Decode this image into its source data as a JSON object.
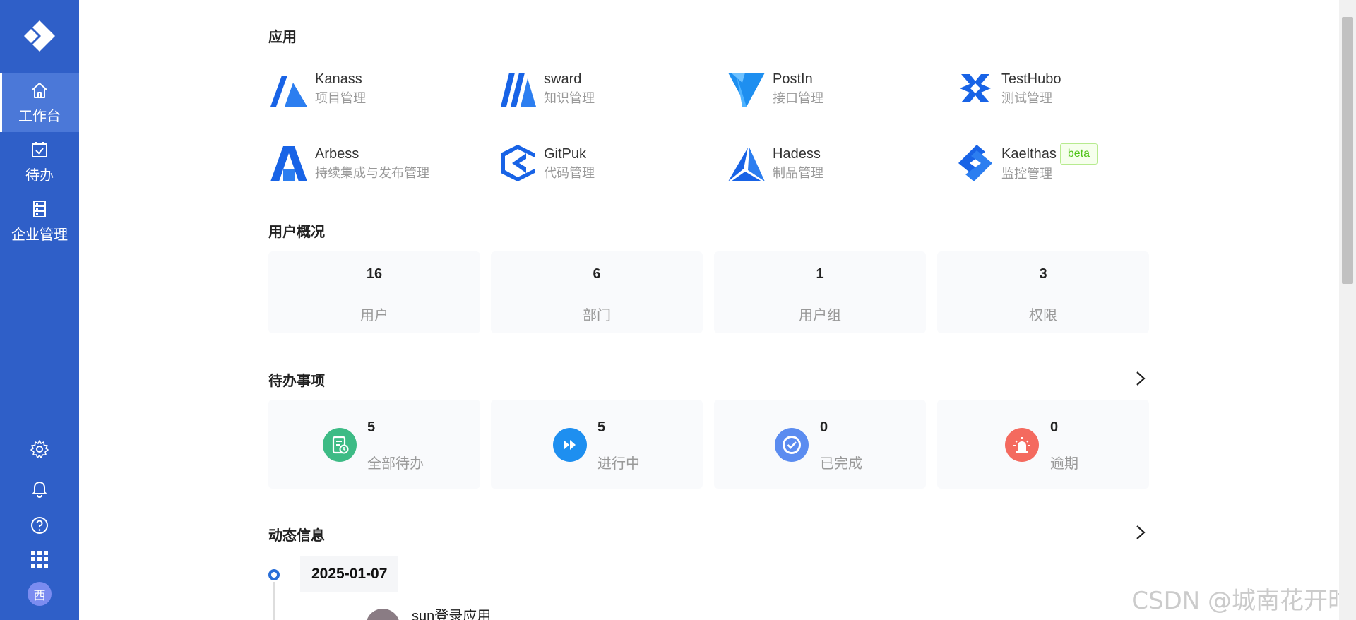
{
  "sidebar": {
    "nav": [
      {
        "label": "工作台",
        "icon": "home-icon",
        "active": true
      },
      {
        "label": "待办",
        "icon": "calendar-check-icon",
        "active": false
      },
      {
        "label": "企业管理",
        "icon": "list-doc-icon",
        "active": false
      }
    ],
    "avatar_text": "西"
  },
  "apps": {
    "title": "应用",
    "items": [
      {
        "name": "Kanass",
        "desc": "项目管理"
      },
      {
        "name": "sward",
        "desc": "知识管理"
      },
      {
        "name": "PostIn",
        "desc": "接口管理"
      },
      {
        "name": "TestHubo",
        "desc": "测试管理"
      },
      {
        "name": "Arbess",
        "desc": "持续集成与发布管理"
      },
      {
        "name": "GitPuk",
        "desc": "代码管理"
      },
      {
        "name": "Hadess",
        "desc": "制品管理"
      },
      {
        "name": "Kaelthas",
        "desc": "监控管理",
        "badge": "beta"
      }
    ]
  },
  "overview": {
    "title": "用户概况",
    "stats": [
      {
        "value": "16",
        "label": "用户"
      },
      {
        "value": "6",
        "label": "部门"
      },
      {
        "value": "1",
        "label": "用户组"
      },
      {
        "value": "3",
        "label": "权限"
      }
    ]
  },
  "todos": {
    "title": "待办事项",
    "items": [
      {
        "value": "5",
        "label": "全部待办",
        "color": "#3dbb85"
      },
      {
        "value": "5",
        "label": "进行中",
        "color": "#1e8ff0"
      },
      {
        "value": "0",
        "label": "已完成",
        "color": "#5b8cf0"
      },
      {
        "value": "0",
        "label": "逾期",
        "color": "#f46a5f"
      }
    ]
  },
  "activity": {
    "title": "动态信息",
    "date": "2025-01-07",
    "entry_text": "sun登录应用"
  },
  "colors": {
    "sidebar": "#2f5fc8",
    "brand_blue": "#2a6fd8"
  },
  "watermark": "CSDN @城南花开时"
}
